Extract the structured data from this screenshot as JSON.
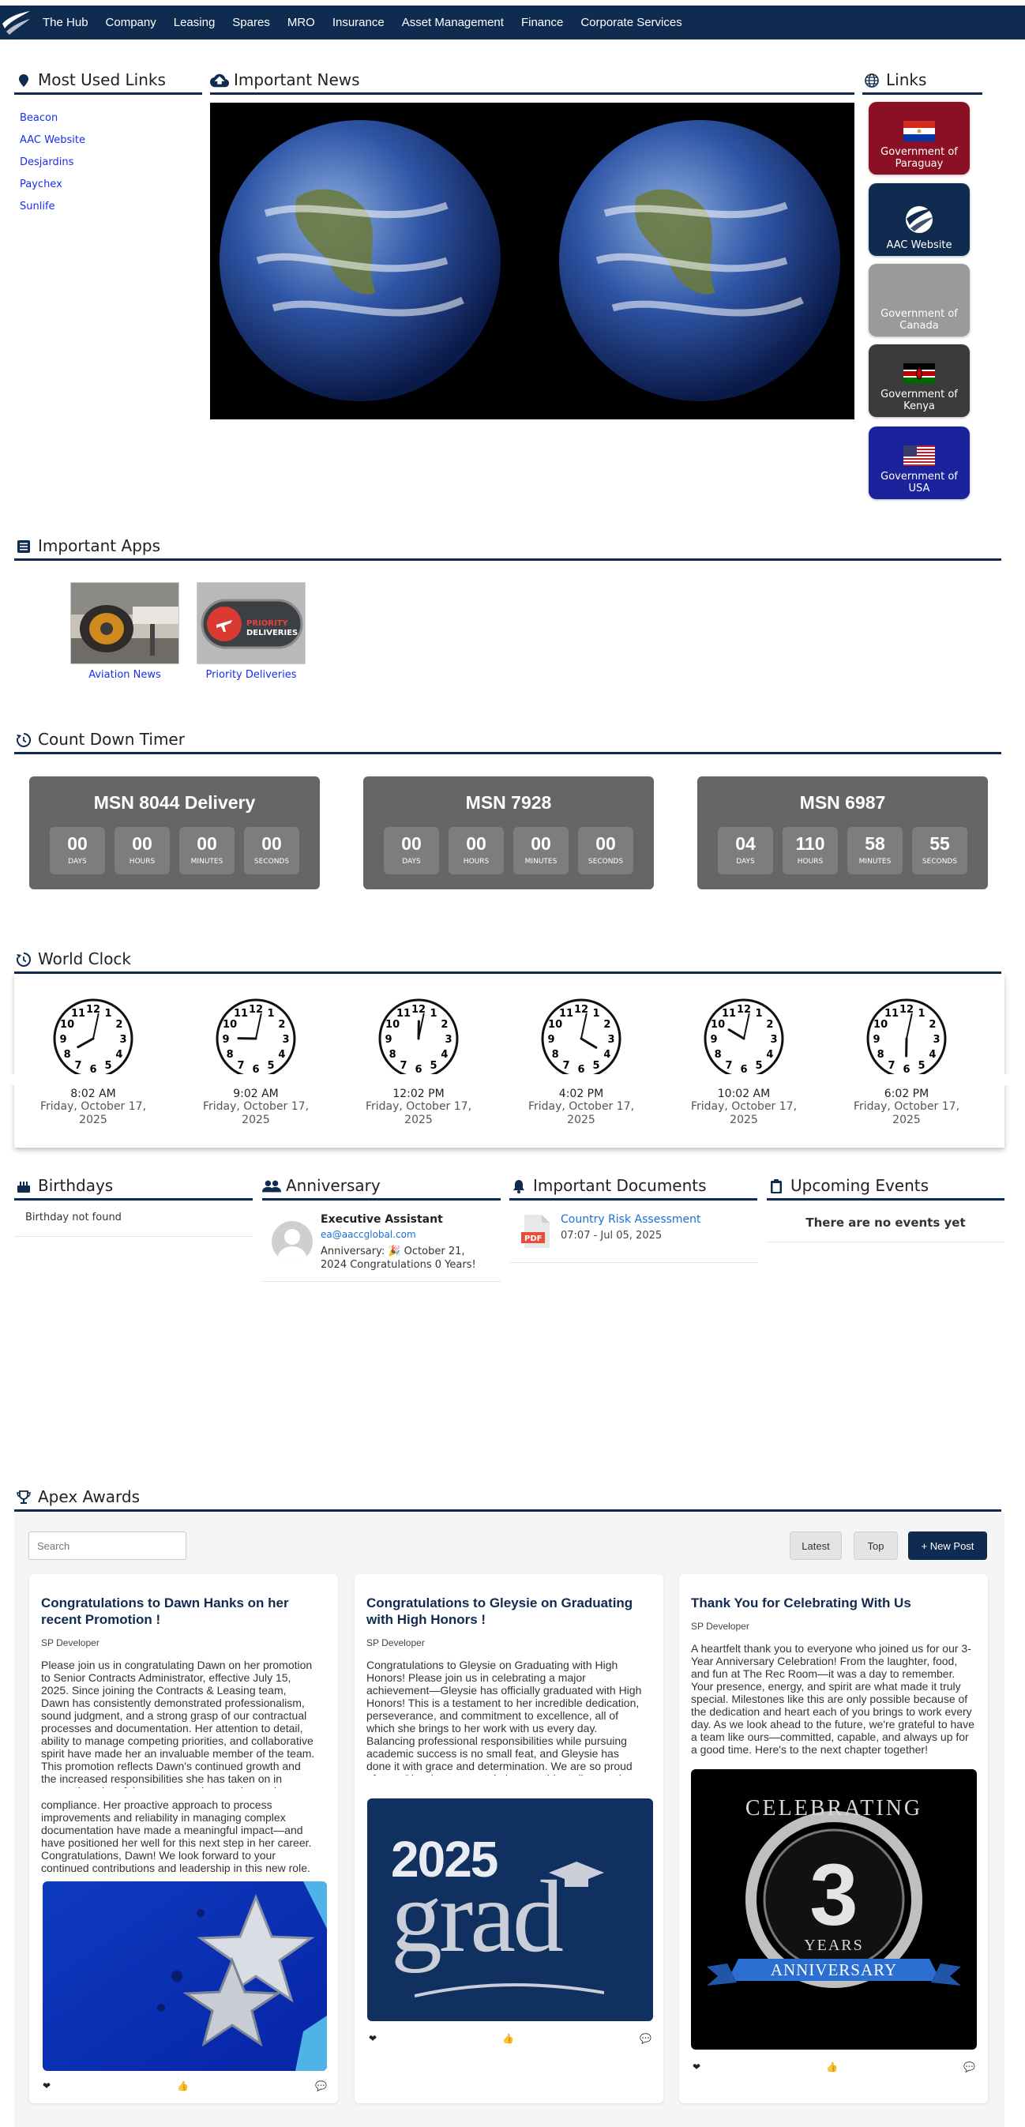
{
  "nav": {
    "items": [
      "The Hub",
      "Company",
      "Leasing",
      "Spares",
      "MRO",
      "Insurance",
      "Asset Management",
      "Finance",
      "Corporate Services"
    ]
  },
  "most_used_links": {
    "title": "Most Used Links",
    "items": [
      "Beacon",
      "AAC Website",
      "Desjardins",
      "Paychex",
      "Sunlife"
    ]
  },
  "important_news": {
    "title": "Important News"
  },
  "links": {
    "title": "Links",
    "tiles": [
      {
        "label": "Government of Paraguay",
        "color": "#8b1024"
      },
      {
        "label": "AAC Website",
        "color": "#0f2b4f"
      },
      {
        "label": "Government of Canada",
        "color": "#9a9a9a"
      },
      {
        "label": "Government of Kenya",
        "color": "#3b3b3b"
      },
      {
        "label": "Government of USA",
        "color": "#1a239b"
      }
    ]
  },
  "important_apps": {
    "title": "Important Apps",
    "apps": [
      "Aviation News",
      "Priority Deliveries"
    ],
    "priority_logo": {
      "line1": "PRIORITY",
      "line2": "DELIVERIES"
    }
  },
  "countdown": {
    "title": "Count Down Timer",
    "units": [
      "DAYS",
      "HOURS",
      "MINUTES",
      "SECONDS"
    ],
    "timers": [
      {
        "name": "MSN 8044 Delivery",
        "values": [
          "00",
          "00",
          "00",
          "00"
        ]
      },
      {
        "name": "MSN 7928",
        "values": [
          "00",
          "00",
          "00",
          "00"
        ]
      },
      {
        "name": "MSN 6987",
        "values": [
          "04",
          "110",
          "58",
          "55"
        ]
      }
    ]
  },
  "world_clock": {
    "title": "World Clock",
    "clocks": [
      {
        "time": "8:02 AM",
        "date": "Friday, October 17, 2025",
        "hour": 8,
        "minute": 2
      },
      {
        "time": "9:02 AM",
        "date": "Friday, October 17, 2025",
        "hour": 9,
        "minute": 2
      },
      {
        "time": "12:02 PM",
        "date": "Friday, October 17, 2025",
        "hour": 12,
        "minute": 2
      },
      {
        "time": "4:02 PM",
        "date": "Friday, October 17, 2025",
        "hour": 4,
        "minute": 2
      },
      {
        "time": "10:02 AM",
        "date": "Friday, October 17, 2025",
        "hour": 10,
        "minute": 2
      },
      {
        "time": "6:02 PM",
        "date": "Friday, October 17, 2025",
        "hour": 6,
        "minute": 2
      }
    ]
  },
  "birthdays": {
    "title": "Birthdays",
    "empty": "Birthday not found"
  },
  "anniversary": {
    "title": "Anniversary",
    "name": "Executive Assistant",
    "email": "ea@aaccglobal.com",
    "text": "Anniversary: 🎉 October 21, 2024 Congratulations 0 Years!"
  },
  "documents": {
    "title": "Important Documents",
    "items": [
      {
        "name": "Country Risk Assessment",
        "meta": "07:07 - Jul 05, 2025"
      }
    ]
  },
  "events": {
    "title": "Upcoming Events",
    "empty": "There are no events yet"
  },
  "awards": {
    "title": "Apex Awards",
    "search_placeholder": "Search",
    "latest_label": "Latest",
    "top_label": "Top",
    "new_post_label": "+ New Post",
    "posts": [
      {
        "title": "Congratulations to Dawn Hanks on her recent Promotion !",
        "author": "SP Developer",
        "body": "Please join us in congratulating Dawn on her promotion to Senior Contracts Administrator, effective July 15, 2025. Since joining the Contracts & Leasing team, Dawn has consistently demonstrated professionalism, sound judgment, and a strong grasp of our contractual processes and documentation. Her attention to detail, ability to manage competing priorities, and collaborative spirit have made her an invaluable member of the team. This promotion reflects Dawn's continued growth and the increased responsibilities she has taken on in supporting aircraft lease transactions and ensuring contract",
        "body2": "compliance. Her proactive approach to process improvements and reliability in managing complex documentation have made a meaningful impact—and have positioned her well for this next step in her career. Congratulations, Dawn! We look forward to your continued contributions and leadership in this new role."
      },
      {
        "title": "Congratulations to Gleysie on Graduating with High Honors !",
        "author": "SP Developer",
        "body": "Congratulations to Gleysie on Graduating with High Honors! Please join us in celebrating a major achievement—Gleysie has officially graduated with High Honors! This is a testament to her incredible dedication, perseverance, and commitment to excellence, all of which she brings to her work with us every day. Balancing professional responsibilities while pursuing academic success is no small feat, and Gleysie has done it with grace and determination. We are so proud of you, Gleysie—congratulations on this well-earned accomplishment!",
        "image_year": "2025",
        "image_word": "grad"
      },
      {
        "title": "Thank You for Celebrating With Us",
        "author": "SP Developer",
        "body": "A heartfelt thank you to everyone who joined us for our 3-Year Anniversary Celebration! From the laughter, food, and fun at The Rec Room—it was a day to remember. Your presence, energy, and spirit are what made it truly special. Milestones like this are only possible because of the dedication and heart each of you brings to work every day. As we look ahead to the future, we're grateful to have a team like ours—committed, capable, and always up for a good time. Here's to the next chapter together!",
        "image_top": "CELEBRATING",
        "image_num": "3",
        "image_years": "YEARS",
        "image_banner": "ANNIVERSARY"
      }
    ]
  }
}
